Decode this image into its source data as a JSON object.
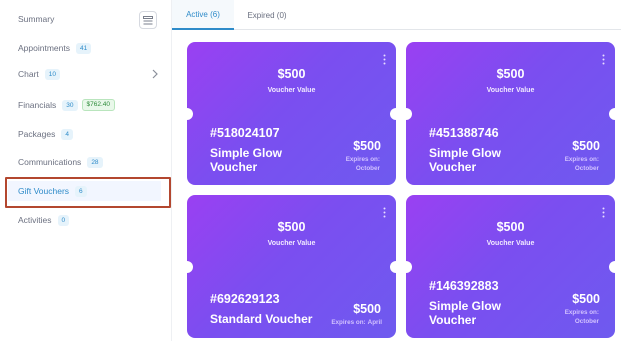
{
  "sidebar": {
    "items": [
      {
        "label": "Summary"
      },
      {
        "label": "Appointments",
        "badge": "41"
      },
      {
        "label": "Chart",
        "badge": "10"
      },
      {
        "label": "Financials",
        "badge": "30",
        "extra": "$762.40"
      },
      {
        "label": "Packages",
        "badge": "4"
      },
      {
        "label": "Communications",
        "badge": "28"
      },
      {
        "label": "Gift Vouchers",
        "badge": "6"
      },
      {
        "label": "Activities",
        "badge": "0"
      }
    ]
  },
  "tabs": [
    {
      "label": "Active (6)"
    },
    {
      "label": "Expired (0)"
    }
  ],
  "vouchers": [
    {
      "top_amount": "$500",
      "top_sub": "Voucher Value",
      "code": "#518024107",
      "name": "Simple Glow Voucher",
      "amount": "$500",
      "expires_label": "Expires on:",
      "expires": "October"
    },
    {
      "top_amount": "$500",
      "top_sub": "Voucher Value",
      "code": "#451388746",
      "name": "Simple Glow Voucher",
      "amount": "$500",
      "expires_label": "Expires on:",
      "expires": "October"
    },
    {
      "top_amount": "$500",
      "top_sub": "Voucher Value",
      "code": "#692629123",
      "name": "Standard Voucher",
      "amount": "$500",
      "expires_label": "Expires on:",
      "expires": "April"
    },
    {
      "top_amount": "$500",
      "top_sub": "Voucher Value",
      "code": "#146392883",
      "name": "Simple Glow Voucher",
      "amount": "$500",
      "expires_label": "Expires on:",
      "expires": "October"
    }
  ],
  "colors": {
    "accent": "#2e8bc9",
    "voucher_start": "#9a40f2",
    "voucher_end": "#6e5aef",
    "highlight_border": "#b3472f"
  },
  "icons": {
    "summary_button": "layout-icon",
    "chart_chevron": "chevron-right-icon",
    "voucher_menu": "more-vertical-icon"
  }
}
